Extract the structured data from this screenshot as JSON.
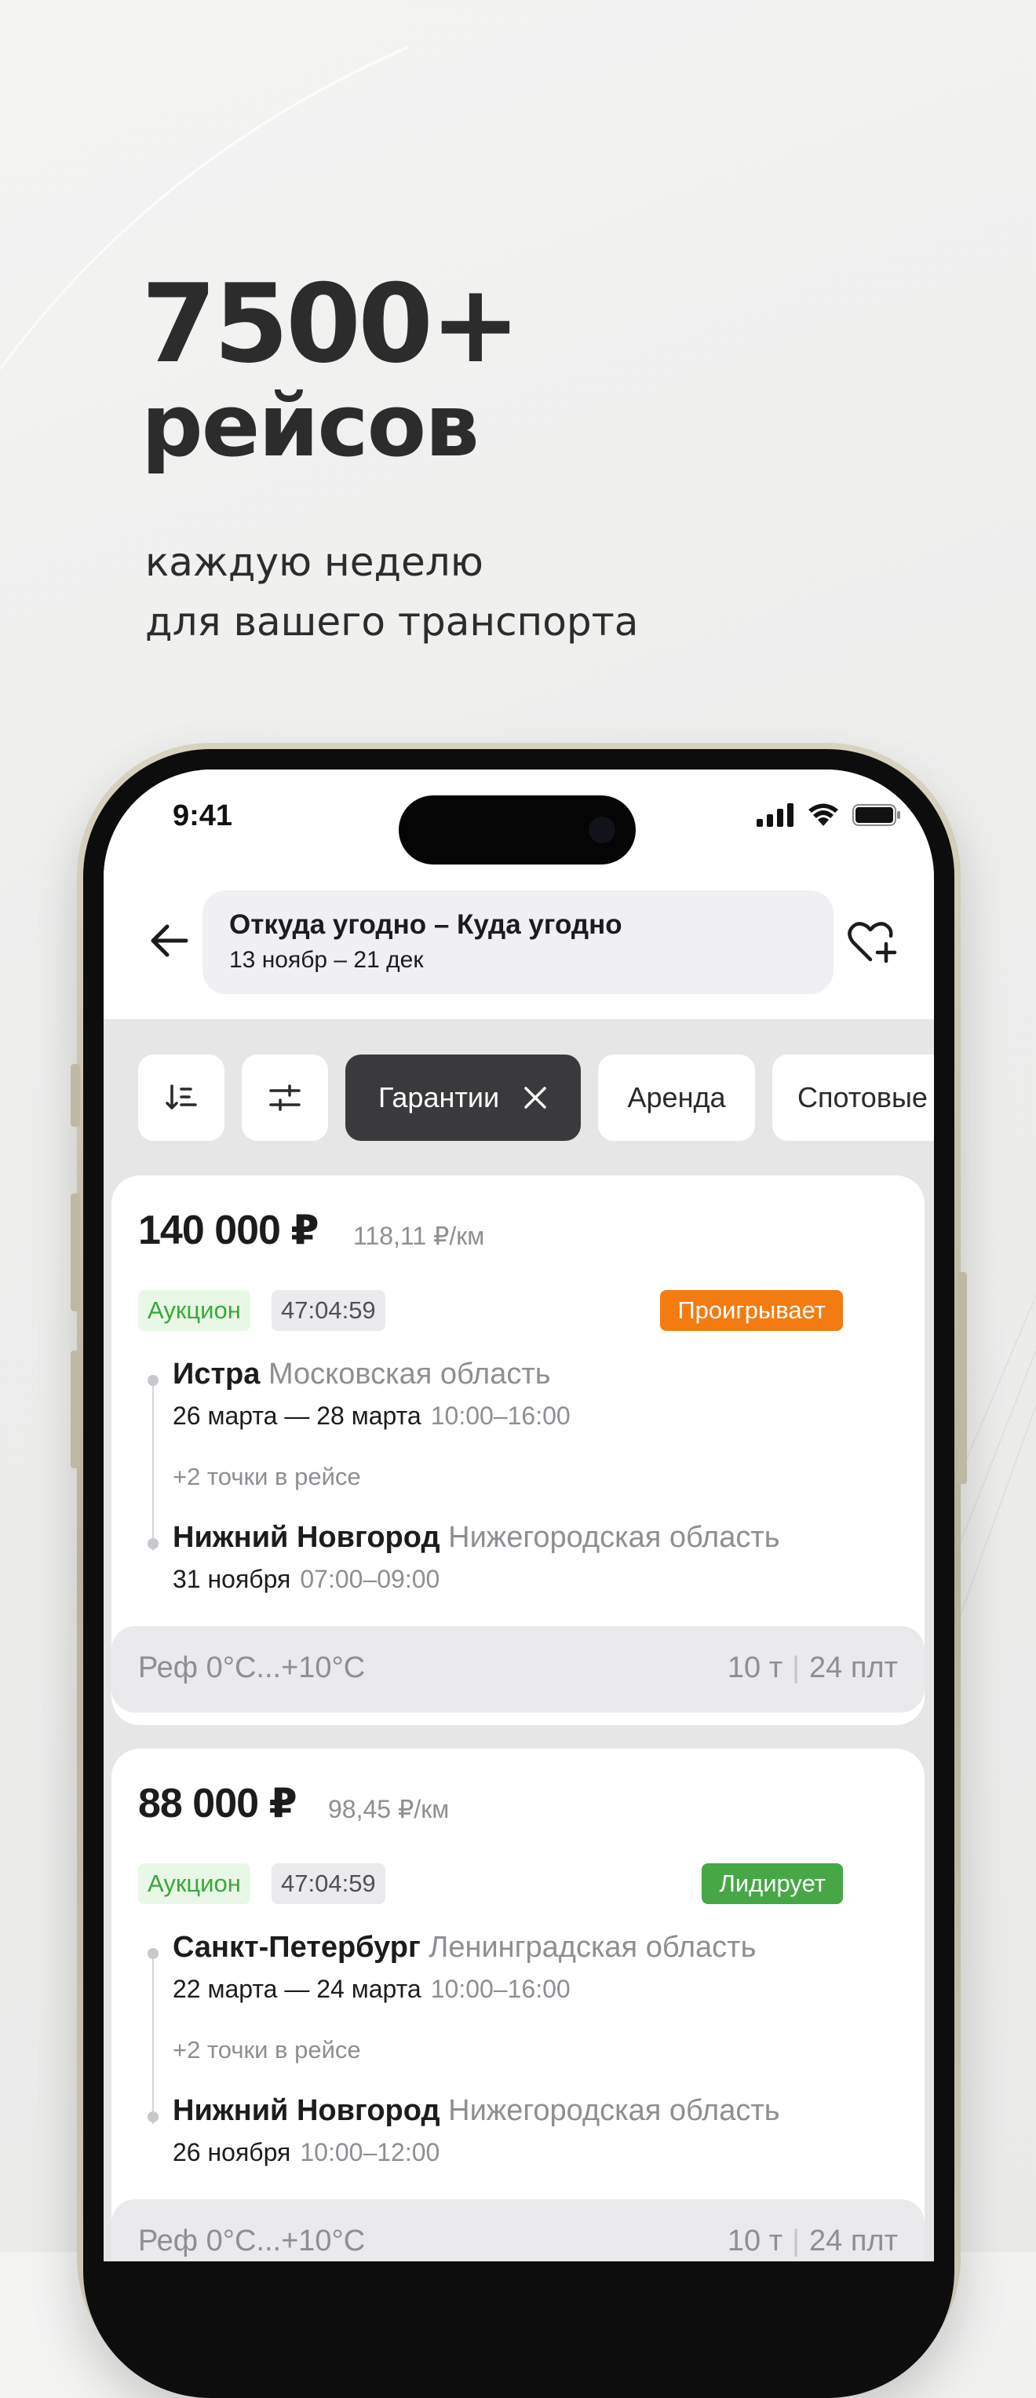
{
  "promo": {
    "headline_number": "7500+",
    "headline_word": "рейсов",
    "subtitle_line1": "каждую неделю",
    "subtitle_line2": "для вашего транспорта"
  },
  "status_bar": {
    "time": "9:41",
    "icons": [
      "signal-icon",
      "wifi-icon",
      "battery-icon"
    ]
  },
  "header": {
    "back_icon": "arrow-left-icon",
    "route_title": "Откуда угодно  –  Куда угодно",
    "route_dates": "13 ноябр – 21 дек",
    "favorite_icon": "heart-plus-icon"
  },
  "filters": {
    "sort_icon": "sort-icon",
    "settings_icon": "sliders-icon",
    "chips": [
      {
        "label": "Гарантии",
        "active": true
      },
      {
        "label": "Аренда",
        "active": false
      },
      {
        "label": "Спотовые",
        "active": false
      }
    ]
  },
  "colors": {
    "lose": "#f47b10",
    "lead": "#45a845",
    "auction_text": "#3aa83a",
    "active_chip": "#3a3a3c"
  },
  "cards": [
    {
      "price": "140 000 ₽",
      "per_km": "118,11 ₽/км",
      "type_tag": "Аукцион",
      "timer": "47:04:59",
      "status": "Проигрывает",
      "from_city": "Истра",
      "from_region": "Московская область",
      "from_date": "26 марта — 28 марта",
      "from_time": "10:00–16:00",
      "extra_points": "+2 точки в рейсе",
      "to_city": "Нижний Новгород",
      "to_region": "Нижегородская область",
      "to_date": "31 ноября",
      "to_time": "07:00–09:00",
      "cargo": "Реф  0°C...+10°C",
      "weight": "10 т",
      "pallets": "24 плт"
    },
    {
      "price": "88 000 ₽",
      "per_km": "98,45 ₽/км",
      "type_tag": "Аукцион",
      "timer": "47:04:59",
      "status": "Лидирует",
      "from_city": "Санкт-Петербург",
      "from_region": "Ленинградская область",
      "from_date": "22 марта — 24 марта",
      "from_time": "10:00–16:00",
      "extra_points": "+2 точки в рейсе",
      "to_city": "Нижний Новгород",
      "to_region": "Нижегородская область",
      "to_date": "26 ноября",
      "to_time": "10:00–12:00",
      "cargo": "Реф  0°C...+10°C",
      "weight": "10 т",
      "pallets": "24 плт"
    }
  ]
}
